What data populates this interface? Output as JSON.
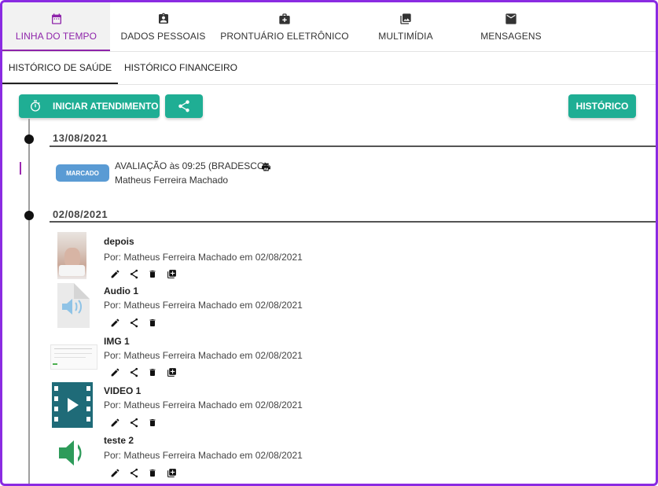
{
  "top_tabs": [
    {
      "label": "LINHA DO TEMPO",
      "icon": "calendar-icon",
      "active": true
    },
    {
      "label": "DADOS PESSOAIS",
      "icon": "id-badge-icon"
    },
    {
      "label": "PRONTUÁRIO ELETRÔNICO",
      "icon": "medical-bag-icon"
    },
    {
      "label": "MULTIMÍDIA",
      "icon": "images-icon"
    },
    {
      "label": "MENSAGENS",
      "icon": "mail-icon"
    }
  ],
  "sub_tabs": [
    {
      "label": "HISTÓRICO DE SAÚDE",
      "active": true
    },
    {
      "label": "HISTÓRICO FINANCEIRO"
    }
  ],
  "toolbar": {
    "start_label": "INICIAR ATENDIMENTO",
    "history_label": "HISTÓRICO"
  },
  "colors": {
    "accent": "#8e24aa",
    "button": "#1fae94",
    "badge": "#5a9bd4",
    "frame": "#8a2be2"
  },
  "timeline": [
    {
      "date": "13/08/2021",
      "appointment": {
        "status": "MARCADO",
        "title": "AVALIAÇÃO às 09:25 (BRADESCO)",
        "person": "Matheus Ferreira Machado"
      }
    },
    {
      "date": "02/08/2021",
      "items": [
        {
          "title": "depois",
          "by": "Por: Matheus Ferreira Machado em 02/08/2021",
          "type": "photo"
        },
        {
          "title": "Audio 1",
          "by": "Por: Matheus Ferreira Machado em 02/08/2021",
          "type": "audio-file"
        },
        {
          "title": "IMG 1",
          "by": "Por: Matheus Ferreira Machado em 02/08/2021",
          "type": "screenshot"
        },
        {
          "title": "VIDEO 1",
          "by": "Por: Matheus Ferreira Machado em 02/08/2021",
          "type": "video"
        },
        {
          "title": "teste 2",
          "by": "Por: Matheus Ferreira Machado em 02/08/2021",
          "type": "speaker"
        }
      ]
    }
  ]
}
